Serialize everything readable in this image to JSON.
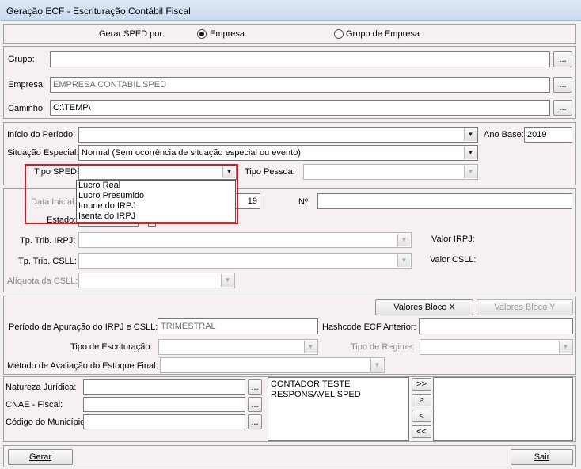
{
  "window": {
    "title": "Geração ECF - Escrituração Contábil Fiscal"
  },
  "sped": {
    "label": "Gerar SPED por:",
    "options": [
      "Empresa",
      "Grupo de Empresa"
    ],
    "selected": "Empresa"
  },
  "grupo": {
    "label": "Grupo:",
    "value": ""
  },
  "empresa": {
    "label": "Empresa:",
    "value": "EMPRESA CONTABIL SPED"
  },
  "caminho": {
    "label": "Caminho:",
    "value": "C:\\TEMP\\"
  },
  "lookup_label": "...",
  "periodo": {
    "label": "Início do Período:",
    "value": ""
  },
  "ano_base": {
    "label": "Ano Base:",
    "value": "2019"
  },
  "situacao": {
    "label": "Situação Especial:",
    "value": "Normal (Sem ocorrência de situação especial ou evento)"
  },
  "tipo_sped": {
    "label": "Tipo SPED:",
    "value": "",
    "options": [
      "Lucro Real",
      "Lucro Presumido",
      "Imune do IRPJ",
      "Isenta do IRPJ"
    ]
  },
  "tipo_pessoa": {
    "label": "Tipo Pessoa:",
    "value": ""
  },
  "data_inicial": {
    "label": "Data Inicial:",
    "partial_value": "19"
  },
  "numero": {
    "label": "Nº:",
    "value": ""
  },
  "estado": {
    "label": "Estado:"
  },
  "trib_irpj": {
    "label": "Tp. Trib. IRPJ:",
    "value": ""
  },
  "valor_irpj": {
    "label": "Valor IRPJ:"
  },
  "trib_csll": {
    "label": "Tp. Trib. CSLL:",
    "value": ""
  },
  "valor_csll": {
    "label": "Valor CSLL:"
  },
  "aliquota": {
    "label": "Alíquota da CSLL:",
    "value": ""
  },
  "bloco": {
    "x_label": "Valores Bloco X",
    "y_label": "Valores Bloco Y"
  },
  "apuracao": {
    "label": "Período de Apuração do IRPJ e CSLL:",
    "value": "TRIMESTRAL"
  },
  "hashcode": {
    "label": "Hashcode ECF Anterior:",
    "value": ""
  },
  "escrituracao": {
    "label": "Tipo de Escrituração:",
    "value": ""
  },
  "regime": {
    "label": "Tipo de Regime:",
    "value": ""
  },
  "estoque": {
    "label": "Método de Avaliação do Estoque Final:",
    "value": ""
  },
  "natureza": {
    "label": "Natureza Jurídica:",
    "value": ""
  },
  "cnae": {
    "label": "CNAE - Fiscal:",
    "value": ""
  },
  "municipio": {
    "label": "Código do Município:",
    "value": ""
  },
  "signatarios": {
    "available": [
      "CONTADOR TESTE",
      "RESPONSAVEL SPED"
    ],
    "selected": []
  },
  "move": {
    "all_right": ">>",
    "right": ">",
    "left": "<",
    "all_left": "<<"
  },
  "actions": {
    "gerar": "Gerar",
    "sair": "Sair"
  }
}
